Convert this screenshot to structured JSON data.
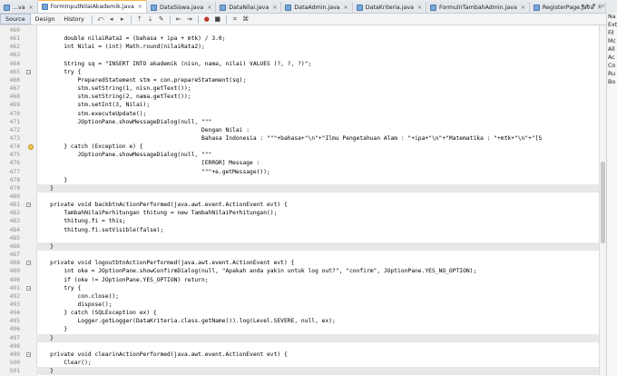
{
  "tabs": [
    {
      "label": "...va",
      "active": false
    },
    {
      "label": "FormInputNilaiAkademik.java",
      "active": true
    },
    {
      "label": "DataSiswa.java",
      "active": false
    },
    {
      "label": "DataNilai.java",
      "active": false
    },
    {
      "label": "DataAdmin.java",
      "active": false
    },
    {
      "label": "DataKriteria.java",
      "active": false
    },
    {
      "label": "FormulirTambahAdmin.java",
      "active": false
    },
    {
      "label": "RegisterPage.java",
      "active": false
    }
  ],
  "toolbar": {
    "source_label": "Source",
    "design_label": "Design",
    "history_label": "History"
  },
  "side_panel": [
    "Na",
    "Ext",
    "Fil",
    "Mc",
    "All",
    "Ac",
    "Co",
    "Ru",
    "Bo"
  ],
  "code_lines": [
    {
      "n": "460",
      "t": ""
    },
    {
      "n": "461",
      "t": "        double nilaiRata2 = (bahasa + ipa + mtk) / 3.0;"
    },
    {
      "n": "462",
      "t": "        int Nilai = (int) Math.round(nilaiRata2);"
    },
    {
      "n": "463",
      "t": ""
    },
    {
      "n": "464",
      "t": "        String sq = \"INSERT INTO akademik (nisn, nama, nilai) VALUES (?, ?, ?)\";"
    },
    {
      "n": "465",
      "t": "        try {",
      "fold": true
    },
    {
      "n": "466",
      "t": "            PreparedStatement stm = con.prepareStatement(sq);"
    },
    {
      "n": "467",
      "t": "            stm.setString(1, nisn.getText());"
    },
    {
      "n": "468",
      "t": "            stm.setString(2, nama.getText());"
    },
    {
      "n": "469",
      "t": "            stm.setInt(3, Nilai);"
    },
    {
      "n": "470",
      "t": "            stm.executeUpdate();"
    },
    {
      "n": "471",
      "t": "            JOptionPane.showMessageDialog(null, \"\"\""
    },
    {
      "n": "472",
      "t": "                                                Dengan Nilai :"
    },
    {
      "n": "473",
      "t": "                                                Bahasa Indonesia : \"\"\"+bahasa+\"\\n\"+\"Ilmu Pengetahuan Alam : \"+ipa+\"\\n\"+\"Matematika : \"+mtk+\"\\n\"+\"[S"
    },
    {
      "n": "474",
      "t": "        } catch (Exception e) {",
      "warn": true
    },
    {
      "n": "475",
      "t": "            JOptionPane.showMessageDialog(null, \"\"\""
    },
    {
      "n": "476",
      "t": "                                                [ERROR] Message :"
    },
    {
      "n": "477",
      "t": "                                                \"\"\"+e.getMessage());"
    },
    {
      "n": "478",
      "t": "        }"
    },
    {
      "n": "479",
      "t": "    }",
      "guard": true
    },
    {
      "n": "480",
      "t": ""
    },
    {
      "n": "481",
      "t": "    private void backbtnActionPerformed(java.awt.event.ActionEvent evt) {",
      "fold": true
    },
    {
      "n": "482",
      "t": "        TambahNilaiPerhitungan thitung = new TambahNilaiPerhitungan();"
    },
    {
      "n": "483",
      "t": "        thitung.fi = this;"
    },
    {
      "n": "484",
      "t": "        thitung.fi.setVisible(false);"
    },
    {
      "n": "485",
      "t": ""
    },
    {
      "n": "486",
      "t": "    }",
      "guard": true
    },
    {
      "n": "487",
      "t": ""
    },
    {
      "n": "488",
      "t": "    private void logoutbtnActionPerformed(java.awt.event.ActionEvent evt) {",
      "fold": true
    },
    {
      "n": "489",
      "t": "        int oke = JOptionPane.showConfirmDialog(null, \"Apakah anda yakin untuk log out?\", \"confirm\", JOptionPane.YES_NO_OPTION);"
    },
    {
      "n": "490",
      "t": "        if (oke != JOptionPane.YES_OPTION) return;"
    },
    {
      "n": "491",
      "t": "        try {",
      "fold": true
    },
    {
      "n": "492",
      "t": "            con.close();"
    },
    {
      "n": "493",
      "t": "            dispose();"
    },
    {
      "n": "494",
      "t": "        } catch (SQLException ex) {"
    },
    {
      "n": "495",
      "t": "            Logger.getLogger(DataKriteria.class.getName()).log(Level.SEVERE, null, ex);"
    },
    {
      "n": "496",
      "t": "        }"
    },
    {
      "n": "497",
      "t": "    }",
      "guard": true
    },
    {
      "n": "498",
      "t": ""
    },
    {
      "n": "499",
      "t": "    private void clearinActionPerformed(java.awt.event.ActionEvent evt) {",
      "fold": true
    },
    {
      "n": "500",
      "t": "        Clear();"
    },
    {
      "n": "501",
      "t": "    }",
      "guard": true
    }
  ]
}
